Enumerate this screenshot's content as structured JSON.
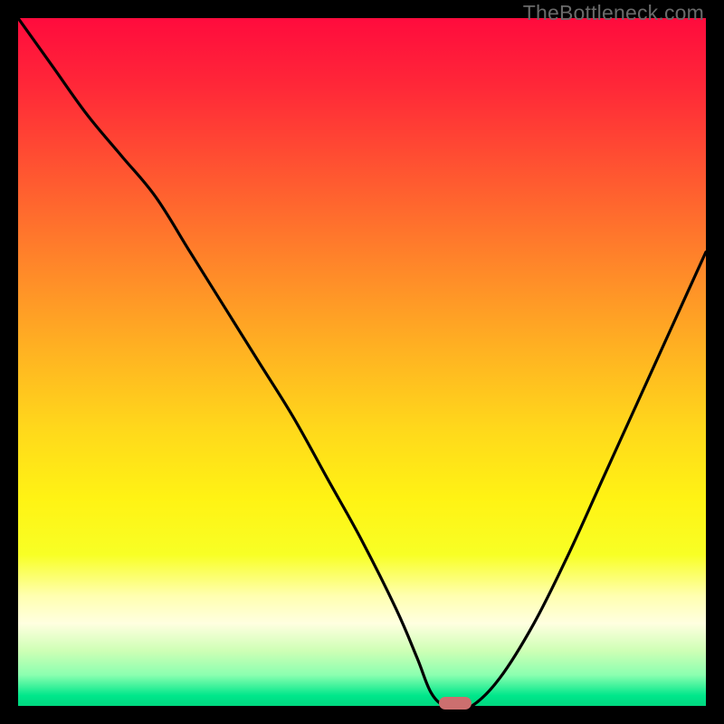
{
  "watermark": "TheBottleneck.com",
  "gradient": {
    "stops": [
      {
        "offset": 0.0,
        "color": "#ff0b3d"
      },
      {
        "offset": 0.1,
        "color": "#ff2838"
      },
      {
        "offset": 0.22,
        "color": "#ff5431"
      },
      {
        "offset": 0.35,
        "color": "#ff832a"
      },
      {
        "offset": 0.48,
        "color": "#ffb122"
      },
      {
        "offset": 0.6,
        "color": "#ffd91b"
      },
      {
        "offset": 0.7,
        "color": "#fff314"
      },
      {
        "offset": 0.78,
        "color": "#f8ff25"
      },
      {
        "offset": 0.84,
        "color": "#ffffb0"
      },
      {
        "offset": 0.88,
        "color": "#ffffe0"
      },
      {
        "offset": 0.92,
        "color": "#ceffb5"
      },
      {
        "offset": 0.955,
        "color": "#8bffb0"
      },
      {
        "offset": 0.985,
        "color": "#00e78b"
      },
      {
        "offset": 1.0,
        "color": "#00d77f"
      }
    ]
  },
  "chart_data": {
    "type": "line",
    "title": "",
    "xlabel": "",
    "ylabel": "",
    "xlim": [
      0,
      100
    ],
    "ylim": [
      0,
      100
    ],
    "grid": false,
    "legend": false,
    "series": [
      {
        "name": "bottleneck-curve",
        "x": [
          0,
          5,
          10,
          15,
          20,
          25,
          30,
          35,
          40,
          45,
          50,
          55,
          58,
          60,
          62,
          64,
          66,
          70,
          75,
          80,
          85,
          90,
          95,
          100
        ],
        "y": [
          100,
          93,
          86,
          80,
          74,
          66,
          58,
          50,
          42,
          33,
          24,
          14,
          7,
          2,
          0,
          0,
          0,
          4,
          12,
          22,
          33,
          44,
          55,
          66
        ]
      }
    ],
    "marker": {
      "x": 63.5,
      "y": 0,
      "color": "#cc6f6f"
    }
  }
}
